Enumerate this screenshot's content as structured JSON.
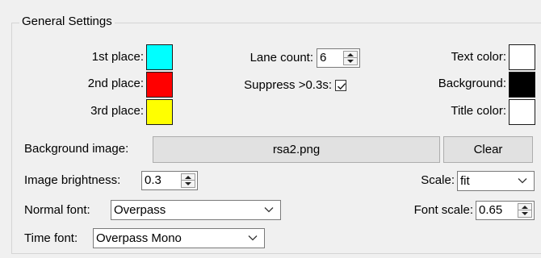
{
  "group": {
    "title": "General Settings"
  },
  "places": [
    {
      "label": "1st place:",
      "color": "#00ffff"
    },
    {
      "label": "2nd place:",
      "color": "#ff0000"
    },
    {
      "label": "3rd place:",
      "color": "#ffff00"
    }
  ],
  "lane_count": {
    "label": "Lane count:",
    "value": "6"
  },
  "suppress": {
    "label": "Suppress >0.3s:",
    "checked": true
  },
  "right_colors": [
    {
      "label": "Text color:",
      "color": "#ffffff"
    },
    {
      "label": "Background:",
      "color": "#000000"
    },
    {
      "label": "Title color:",
      "color": "#ffffff"
    }
  ],
  "background_image": {
    "label": "Background image:",
    "file": "rsa2.png",
    "clear_label": "Clear"
  },
  "image_brightness": {
    "label": "Image brightness:",
    "value": "0.3"
  },
  "scale": {
    "label": "Scale:",
    "value": "fit"
  },
  "normal_font": {
    "label": "Normal font:",
    "value": "Overpass"
  },
  "font_scale": {
    "label": "Font scale:",
    "value": "0.65"
  },
  "time_font": {
    "label": "Time font:",
    "value": "Overpass Mono"
  },
  "icons": {
    "spin": "spin-arrows-icon",
    "dropdown": "chevron-down-icon",
    "check": "checkmark-icon"
  }
}
